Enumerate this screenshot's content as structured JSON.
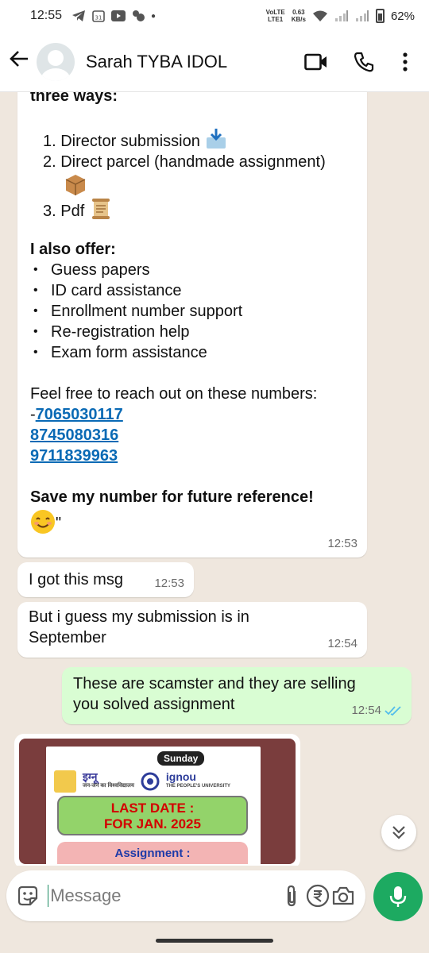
{
  "status_bar": {
    "time": "12:55",
    "network_top": "VoLTE",
    "network_bottom": "LTE1",
    "speed_top": "0.63",
    "speed_bottom": "KB/s",
    "battery": "62%"
  },
  "header": {
    "contact_name": "Sarah TYBA IDOL"
  },
  "message1": {
    "partial_top": "three ways:",
    "ways": [
      "1. Director submission",
      "2. Direct parcel (handmade assignment)",
      "3. Pdf"
    ],
    "offer_title": "I also offer:",
    "offers": [
      "Guess papers",
      "ID card assistance",
      "Enrollment number support",
      "Re-registration help",
      "Exam form assistance"
    ],
    "reach_text": "Feel free to reach out on these numbers:",
    "numbers": [
      "7065030117",
      "8745080316",
      "9711839963"
    ],
    "number_prefix": "-",
    "save_text": "Save my number for future reference!",
    "trailing_quote": "\"",
    "time": "12:53"
  },
  "message2": {
    "text": "I got this msg",
    "time": "12:53"
  },
  "message3": {
    "line1": "But i guess my submission is in",
    "line2": "September",
    "time": "12:54"
  },
  "message4": {
    "line1": "These are scamster and they are selling",
    "line2": "you solved assignment",
    "time": "12:54"
  },
  "image_preview": {
    "badge": "Sunday",
    "logo_hindi": "इग्नू",
    "logo_hindi_sub": "जन-जन का विश्वविद्यालय",
    "logo_english": "ignou",
    "logo_english_sub": "THE PEOPLE'S UNIVERSITY",
    "last_date_line1": "LAST DATE :",
    "last_date_line2": "FOR JAN. 2025",
    "assignment": "Assignment :"
  },
  "input": {
    "placeholder": "Message"
  },
  "colors": {
    "accent_green": "#1daa61",
    "outgoing_bubble": "#d9fdd3",
    "chat_bg": "#efe7de",
    "link_blue": "#0a6ab5",
    "read_ticks": "#53bdeb"
  }
}
